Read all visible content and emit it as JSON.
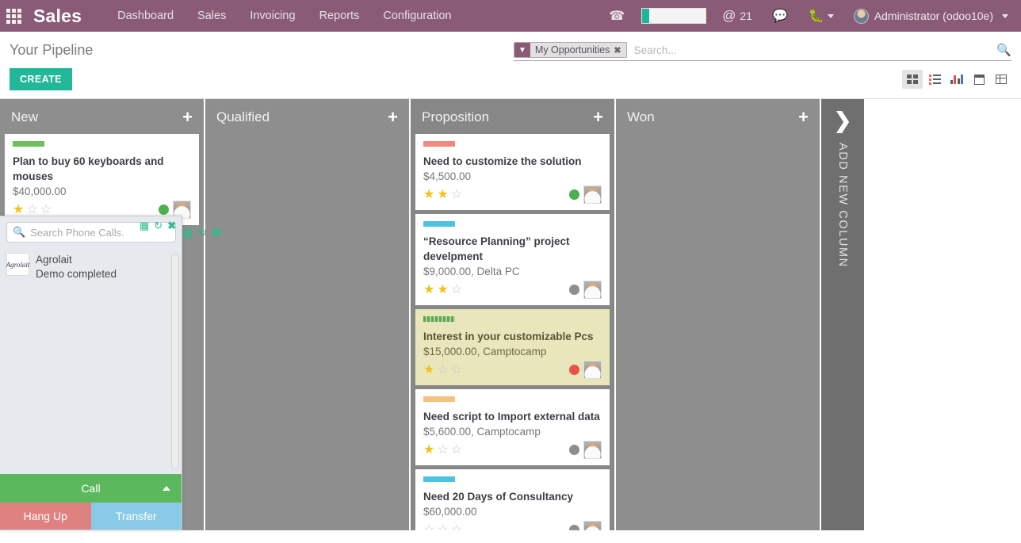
{
  "navbar": {
    "apps_icon": "apps-grid-icon",
    "brand": "Sales",
    "menu": [
      {
        "label": "Dashboard"
      },
      {
        "label": "Sales"
      },
      {
        "label": "Invoicing"
      },
      {
        "label": "Reports"
      },
      {
        "label": "Configuration"
      }
    ],
    "phone_icon": "phone-icon",
    "dial_value": "",
    "mentions": {
      "at": "@",
      "count": "21",
      "icon": "at-mention-icon"
    },
    "chat_icon": "chat-bubble-icon",
    "debug_icon": "bug-icon",
    "user": "Administrator (odoo10e)",
    "accent_color": "#8a5b77",
    "dial_accent_color": "#1cb698"
  },
  "control_panel": {
    "page_title": "Your Pipeline",
    "create_label": "CREATE",
    "create_color": "#21b799",
    "search": {
      "facet_label": "My Opportunities",
      "facet_icon": "filter-icon",
      "facet_close": "✖",
      "placeholder": "Search...",
      "value": "",
      "zoom_icon": "search-plus-icon"
    },
    "views": [
      {
        "name": "kanban",
        "label": "Kanban",
        "active": true
      },
      {
        "name": "list",
        "label": "List",
        "active": false
      },
      {
        "name": "graph",
        "label": "Graph",
        "active": false
      },
      {
        "name": "calendar",
        "label": "Calendar",
        "active": false
      },
      {
        "name": "pivot",
        "label": "Pivot",
        "active": false
      }
    ]
  },
  "kanban": {
    "add_column_label": "ADD NEW COLUMN",
    "add_column_icon": "chevron-right-icon",
    "add_icon": "plus-icon",
    "columns": [
      {
        "title": "New",
        "cards": [
          {
            "bar_color": "#6fbf5c",
            "bar_dashed": false,
            "title": "Plan to buy 60 keyboards and mouses",
            "amount": "$40,000.00",
            "stars": 1,
            "dot_color": "#4caf50",
            "highlight": false
          }
        ]
      },
      {
        "title": "Qualified",
        "cards": []
      },
      {
        "title": "Proposition",
        "cards": [
          {
            "bar_color": "#ef8a7c",
            "bar_dashed": false,
            "title": "Need to customize the solution",
            "amount": "$4,500.00",
            "stars": 2,
            "dot_color": "#4caf50",
            "highlight": false
          },
          {
            "bar_color": "#4ec3e0",
            "bar_dashed": false,
            "title": "“Resource Planning” project develpment",
            "amount": "$9,000.00, Delta PC",
            "stars": 2,
            "dot_color": "#8e8e8e",
            "highlight": false
          },
          {
            "bar_color": "#5aa84f",
            "bar_dashed": true,
            "title": "Interest in your customizable Pcs",
            "amount": "$15,000.00, Camptocamp",
            "stars": 1,
            "dot_color": "#e8544a",
            "highlight": true
          },
          {
            "bar_color": "#f5c27d",
            "bar_dashed": false,
            "title": "Need script to Import external data",
            "amount": "$5,600.00, Camptocamp",
            "stars": 1,
            "dot_color": "#8e8e8e",
            "highlight": false
          },
          {
            "bar_color": "#4ec3e0",
            "bar_dashed": false,
            "title": "Need 20 Days of Consultancy",
            "amount": "$60,000.00",
            "stars": 0,
            "dot_color": "#8e8e8e",
            "highlight": false
          }
        ]
      },
      {
        "title": "Won",
        "cards": []
      }
    ]
  },
  "voip": {
    "search_placeholder": "Search Phone Calls.",
    "search_value": "",
    "search_icon": "search-icon",
    "tool_list_icon": "list-view-icon",
    "tool_refresh_icon": "refresh-icon",
    "tool_close_icon": "close-icon",
    "items": [
      {
        "logo_text": "Agrolait",
        "name": "Agrolait",
        "state": "Demo completed"
      }
    ],
    "call_label": "Call",
    "call_caret_icon": "caret-up-icon",
    "hangup_label": "Hang Up",
    "transfer_label": "Transfer",
    "call_color": "#5cb85c",
    "hangup_color": "#e08181",
    "transfer_color": "#89cbe6"
  },
  "card_tools": {
    "grid_icon": "grid-icon",
    "refresh_icon": "refresh-icon",
    "close_icon": "close-icon"
  }
}
